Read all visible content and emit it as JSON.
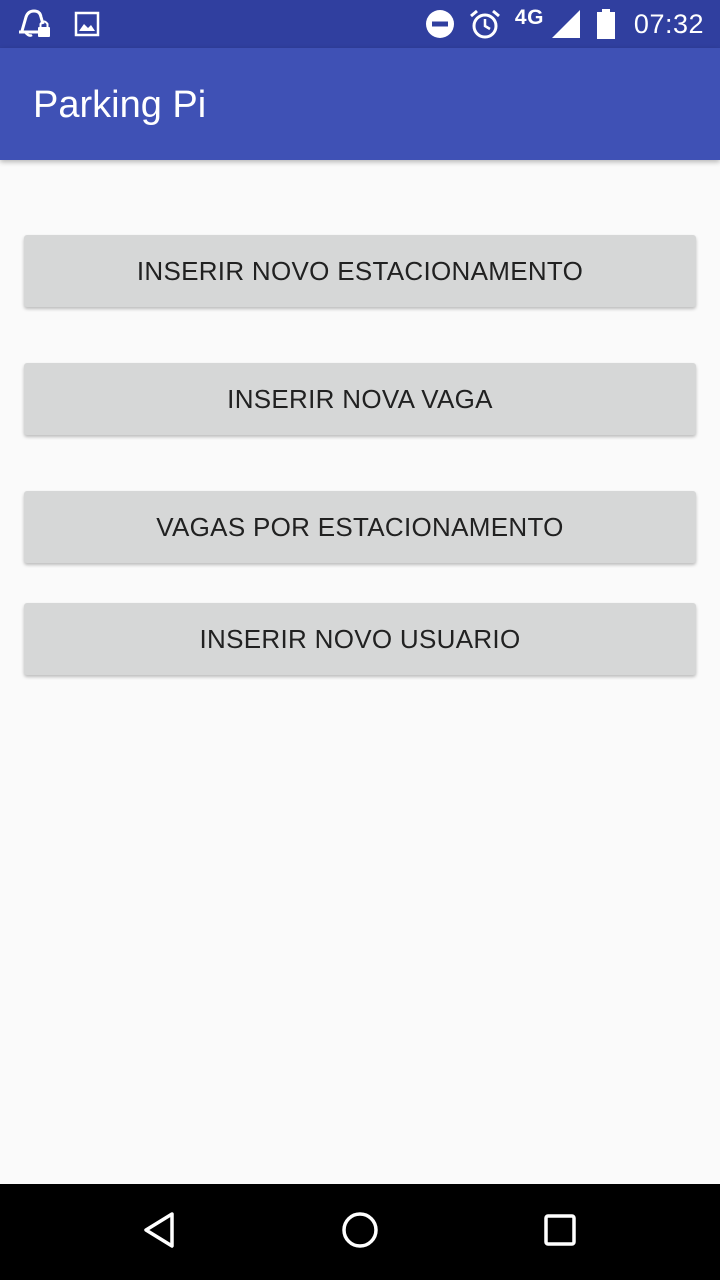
{
  "status_bar": {
    "left_icons": [
      "notification-bell-lock-icon",
      "image-icon"
    ],
    "right_icons": [
      "do-not-disturb-icon",
      "alarm-icon",
      "signal-icon",
      "battery-icon"
    ],
    "network": "4G",
    "time": "07:32"
  },
  "app_bar": {
    "title": "Parking Pi"
  },
  "buttons": [
    {
      "label": "INSERIR NOVO ESTACIONAMENTO"
    },
    {
      "label": "INSERIR NOVA VAGA"
    },
    {
      "label": "VAGAS POR ESTACIONAMENTO"
    },
    {
      "label": "INSERIR NOVO USUARIO"
    }
  ],
  "nav_bar": {
    "icons": [
      "back-triangle-icon",
      "home-circle-icon",
      "recents-square-icon"
    ]
  },
  "colors": {
    "status_bar": "#303f9f",
    "app_bar": "#3f51b5",
    "background": "#fafafa",
    "button": "#d6d7d7",
    "button_text": "#212121",
    "nav_bar": "#000000"
  }
}
